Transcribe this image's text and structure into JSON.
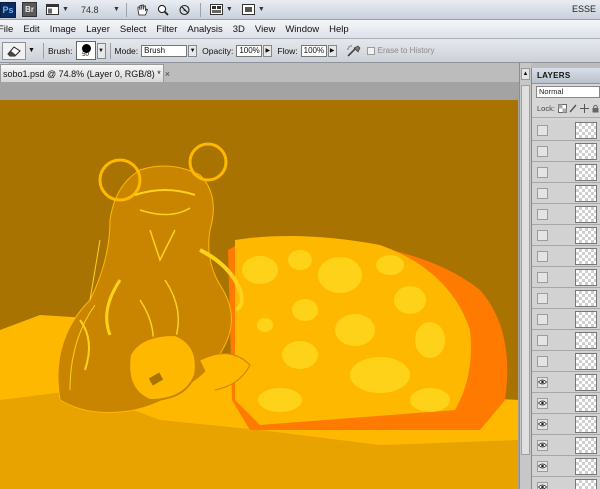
{
  "appbar": {
    "ps_logo": "Ps",
    "br_logo": "Br",
    "zoom": "74.8",
    "workspace": "ESSE"
  },
  "menu": [
    "File",
    "Edit",
    "Image",
    "Layer",
    "Select",
    "Filter",
    "Analysis",
    "3D",
    "View",
    "Window",
    "Help"
  ],
  "options": {
    "brush_label": "Brush:",
    "brush_size": "50",
    "mode_label": "Mode:",
    "mode_value": "Brush",
    "opacity_label": "Opacity:",
    "opacity_value": "100%",
    "flow_label": "Flow:",
    "flow_value": "100%",
    "erase_to_history": "Erase to History"
  },
  "document": {
    "tab_title": "sobo1.psd @ 74.8% (Layer 0, RGB/8) *"
  },
  "colors": {
    "canvas_bg": "#a87300",
    "cheese": "#ffb800",
    "cheese_light": "#ffd21a",
    "rind": "#ff7a00",
    "mouse_lines": "#e9a600"
  },
  "layers_panel": {
    "title": "LAYERS",
    "blend_mode": "Normal",
    "lock_label": "Lock:",
    "rows": [
      {
        "visible": false
      },
      {
        "visible": false
      },
      {
        "visible": false
      },
      {
        "visible": false
      },
      {
        "visible": false
      },
      {
        "visible": false
      },
      {
        "visible": false
      },
      {
        "visible": false
      },
      {
        "visible": false
      },
      {
        "visible": false
      },
      {
        "visible": false
      },
      {
        "visible": false
      },
      {
        "visible": true
      },
      {
        "visible": true
      },
      {
        "visible": true
      },
      {
        "visible": true
      },
      {
        "visible": true
      },
      {
        "visible": true
      }
    ]
  }
}
